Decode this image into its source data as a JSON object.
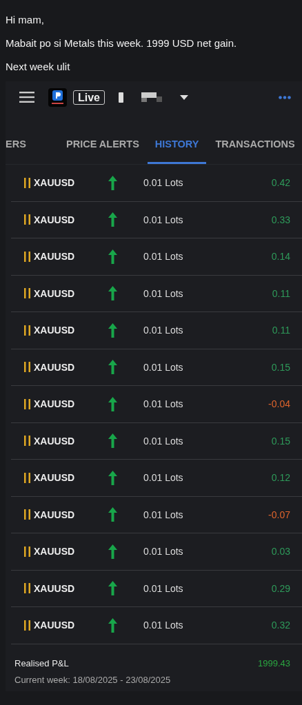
{
  "message": {
    "lines": [
      "Hi mam,",
      "Mabait po si Metals this week. 1999 USD net gain.",
      "Next week ulit"
    ]
  },
  "app": {
    "header": {
      "account_badge": "Live"
    },
    "tabs": [
      {
        "label": "ERS",
        "selected": false
      },
      {
        "label": "PRICE ALERTS",
        "selected": false
      },
      {
        "label": "HISTORY",
        "selected": true
      },
      {
        "label": "TRANSACTIONS",
        "selected": false
      }
    ],
    "trades": [
      {
        "symbol": "XAUUSD",
        "lots": "0.01 Lots",
        "pnl": "0.42",
        "color": "#2e9a5a"
      },
      {
        "symbol": "XAUUSD",
        "lots": "0.01 Lots",
        "pnl": "0.33",
        "color": "#2e9a5a"
      },
      {
        "symbol": "XAUUSD",
        "lots": "0.01 Lots",
        "pnl": "0.14",
        "color": "#2e9a5a"
      },
      {
        "symbol": "XAUUSD",
        "lots": "0.01 Lots",
        "pnl": "0.11",
        "color": "#2e9a5a"
      },
      {
        "symbol": "XAUUSD",
        "lots": "0.01 Lots",
        "pnl": "0.11",
        "color": "#2e9a5a"
      },
      {
        "symbol": "XAUUSD",
        "lots": "0.01 Lots",
        "pnl": "0.15",
        "color": "#2e9a5a"
      },
      {
        "symbol": "XAUUSD",
        "lots": "0.01 Lots",
        "pnl": "-0.04",
        "color": "#e0642c"
      },
      {
        "symbol": "XAUUSD",
        "lots": "0.01 Lots",
        "pnl": "0.15",
        "color": "#2e9a5a"
      },
      {
        "symbol": "XAUUSD",
        "lots": "0.01 Lots",
        "pnl": "0.12",
        "color": "#2e9a5a"
      },
      {
        "symbol": "XAUUSD",
        "lots": "0.01 Lots",
        "pnl": "-0.07",
        "color": "#e0642c"
      },
      {
        "symbol": "XAUUSD",
        "lots": "0.01 Lots",
        "pnl": "0.03",
        "color": "#2e9a5a"
      },
      {
        "symbol": "XAUUSD",
        "lots": "0.01 Lots",
        "pnl": "0.29",
        "color": "#2e9a5a"
      },
      {
        "symbol": "XAUUSD",
        "lots": "0.01 Lots",
        "pnl": "0.32",
        "color": "#2e9a5a"
      }
    ],
    "summary": {
      "label": "Realised P&L",
      "value": "1999.43",
      "period": "Current week: 18/08/2025 - 23/08/2025"
    }
  }
}
